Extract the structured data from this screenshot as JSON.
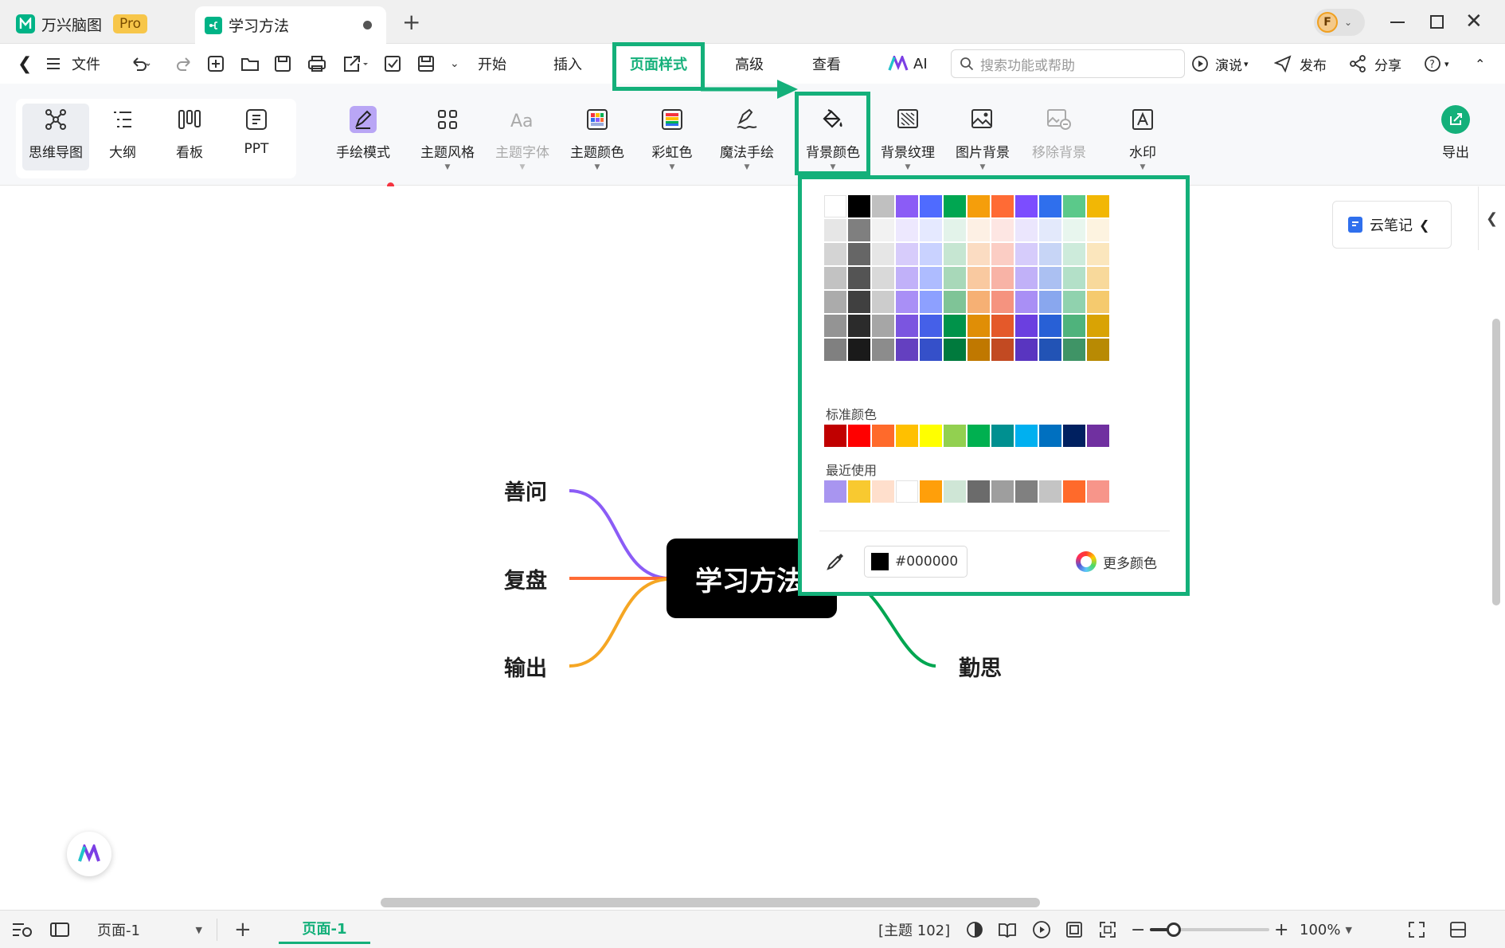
{
  "tabs": {
    "app_name": "万兴脑图",
    "pro_badge": "Pro",
    "doc_title": "学习方法"
  },
  "menu": {
    "file": "文件",
    "start": "开始",
    "insert": "插入",
    "page_style": "页面样式",
    "advanced": "高级",
    "view": "查看",
    "ai": "AI",
    "search_placeholder": "搜索功能或帮助",
    "present": "演说",
    "publish": "发布",
    "share": "分享"
  },
  "ribbon": {
    "mindmap": "思维导图",
    "outline": "大纲",
    "kanban": "看板",
    "ppt": "PPT",
    "handdrawn_mode": "手绘模式",
    "theme_style": "主题风格",
    "theme_font": "主题字体",
    "theme_color": "主题颜色",
    "rainbow": "彩虹色",
    "magic_handdraw": "魔法手绘",
    "bg_color": "背景颜色",
    "bg_texture": "背景纹理",
    "image_bg": "图片背景",
    "remove_bg": "移除背景",
    "watermark": "水印",
    "export": "导出"
  },
  "side": {
    "cloud_note": "云笔记"
  },
  "mindmap": {
    "central": "学习方法",
    "topics": [
      "善问",
      "复盘",
      "输出",
      "勤思"
    ]
  },
  "palette": {
    "theme_grid": [
      [
        "#ffffff",
        "#000000",
        "#c0c0c0",
        "#8b5cf6",
        "#4f6bff",
        "#00a651",
        "#f59e0b",
        "#ff6b35",
        "#7c4dff",
        "#2f6fed",
        "#5bc98a",
        "#f2b705"
      ],
      [
        "#e6e6e6",
        "#7f7f7f",
        "#f2f2f2",
        "#ede8fe",
        "#e5e9ff",
        "#e3f3ea",
        "#fdf0e4",
        "#fde6e3",
        "#ebe6fd",
        "#e3e9fb",
        "#e8f6ee",
        "#fdf3e0"
      ],
      [
        "#d4d4d4",
        "#666666",
        "#e6e6e6",
        "#d7ccfb",
        "#c9d2ff",
        "#c6e6d2",
        "#fbdcc2",
        "#fbcdc4",
        "#d6ccfb",
        "#c7d5f6",
        "#cdebdb",
        "#fbe6bd"
      ],
      [
        "#c2c2c2",
        "#545454",
        "#d9d9d9",
        "#c1b1f9",
        "#aebcff",
        "#a8d8b9",
        "#f9c9a0",
        "#f8b3a6",
        "#c1b1f8",
        "#abc0f2",
        "#b3e0c8",
        "#f8d99b"
      ],
      [
        "#ababab",
        "#404040",
        "#cccccc",
        "#a98ff6",
        "#8da0ff",
        "#7fc497",
        "#f6b074",
        "#f5937f",
        "#a98ff5",
        "#89a7ee",
        "#90d2ae",
        "#f5ca6e"
      ],
      [
        "#949494",
        "#2b2b2b",
        "#a6a6a6",
        "#7b55e0",
        "#4560e8",
        "#00934a",
        "#e08e06",
        "#e4592a",
        "#6b3fe0",
        "#2860d6",
        "#4fb37c",
        "#d9a304"
      ],
      [
        "#808080",
        "#1a1a1a",
        "#8c8c8c",
        "#6440c0",
        "#3550c9",
        "#007a3d",
        "#c07800",
        "#c24a22",
        "#5935c0",
        "#2253b5",
        "#3f9466",
        "#b88a03"
      ]
    ],
    "standard_label": "标准颜色",
    "standard": [
      "#c00000",
      "#ff0000",
      "#ff6a2b",
      "#ffc000",
      "#ffff00",
      "#92d050",
      "#00b050",
      "#009090",
      "#00b0f0",
      "#0070c0",
      "#002060",
      "#7030a0"
    ],
    "recent_label": "最近使用",
    "recent": [
      "#a895f0",
      "#f8c930",
      "#ffdfcc",
      "#ffffff",
      "#ff9f0a",
      "#cfe6d6",
      "#6b6b6b",
      "#9e9e9e",
      "#808080",
      "#c4c4c4",
      "#ff6a2b",
      "#f7958a"
    ],
    "hex_value": "#000000",
    "more_colors": "更多颜色"
  },
  "status": {
    "page_select": "页面-1",
    "page_tab": "页面-1",
    "topic_count": "[主题 102]",
    "zoom": "100%",
    "zoom_level": 0.2
  },
  "colors": {
    "accent": "#14b07a",
    "branch_purple": "#8b5cf6",
    "branch_orange": "#ff6b35",
    "branch_yellow": "#f5a623",
    "branch_green": "#00a651"
  }
}
